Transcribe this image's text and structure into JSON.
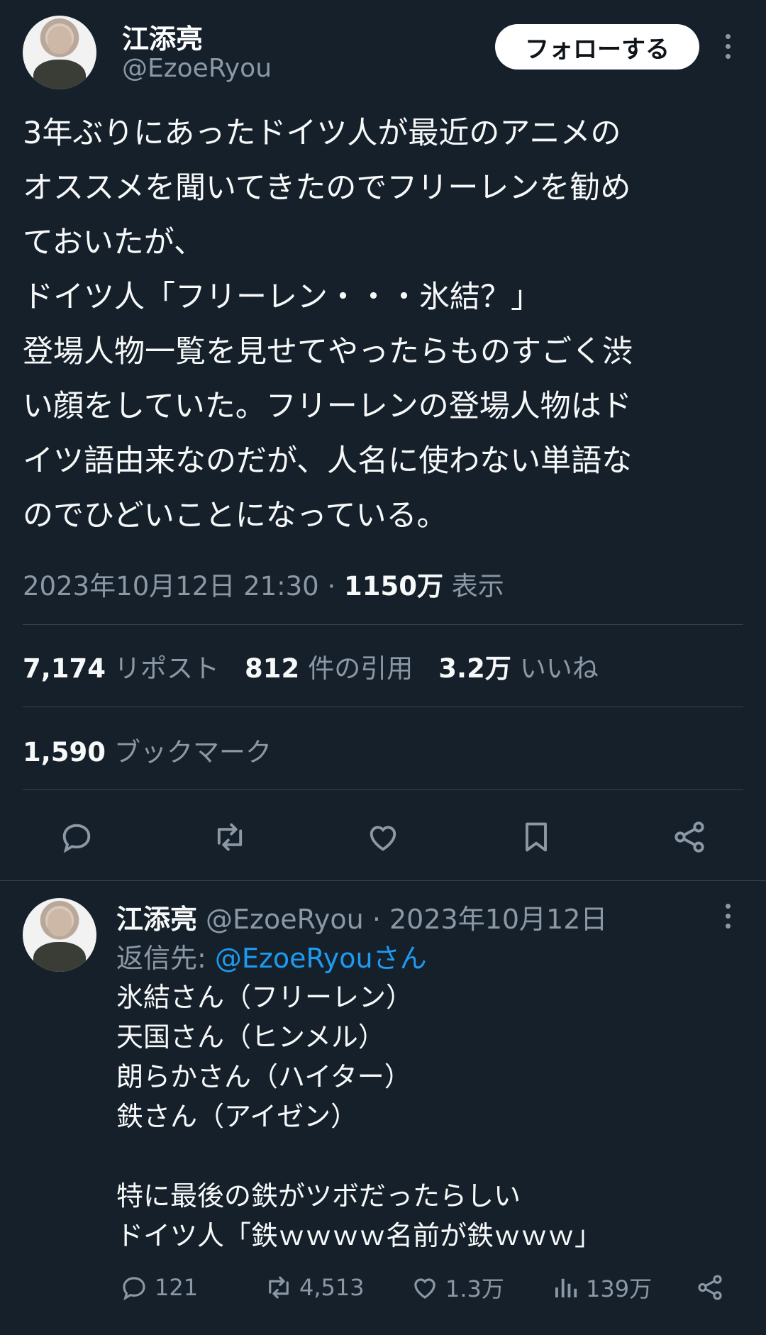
{
  "tweet": {
    "author_name": "江添亮",
    "author_handle": "@EzoeRyou",
    "follow_label": "フォローする",
    "text": "3年ぶりにあったドイツ人が最近のアニメの\nオススメを聞いてきたのでフリーレンを勧め\nておいたが、\nドイツ人「フリーレン・・・氷結？」\n登場人物一覧を見せてやったらものすごく渋\nい顔をしていた。フリーレンの登場人物はド\nイツ語由来なのだが、人名に使わない単語な\nのでひどいことになっている。",
    "timestamp": "2023年10月12日 21:30",
    "separator": " · ",
    "views_count": "1150万",
    "views_label": " 表示",
    "stats": {
      "reposts_count": "7,174",
      "reposts_label": "リポスト",
      "quotes_count": "812",
      "quotes_label": "件の引用",
      "likes_count": "3.2万",
      "likes_label": "いいね",
      "bookmarks_count": "1,590",
      "bookmarks_label": "ブックマーク"
    },
    "actions": [
      "reply-icon",
      "repost-icon",
      "like-icon",
      "bookmark-icon",
      "share-icon"
    ]
  },
  "reply": {
    "author_name": "江添亮",
    "author_handle": "@EzoeRyou",
    "date": " · 2023年10月12日",
    "reply_to_prefix": "返信先: ",
    "reply_to_mention": "@EzoeRyouさん",
    "text": "氷結さん（フリーレン）\n天国さん（ヒンメル）\n朗らかさん（ハイター）\n鉄さん（アイゼン）\n\n特に最後の鉄がツボだったらしい\nドイツ人「鉄ｗｗｗｗ名前が鉄ｗｗｗ」",
    "replies": "121",
    "reposts": "4,513",
    "likes": "1.3万",
    "views": "139万"
  },
  "colors": {
    "background": "#15202b",
    "text": "#f7f9f9",
    "secondary": "#8b98a5",
    "link": "#1d9bf0",
    "divider": "#38444d"
  }
}
